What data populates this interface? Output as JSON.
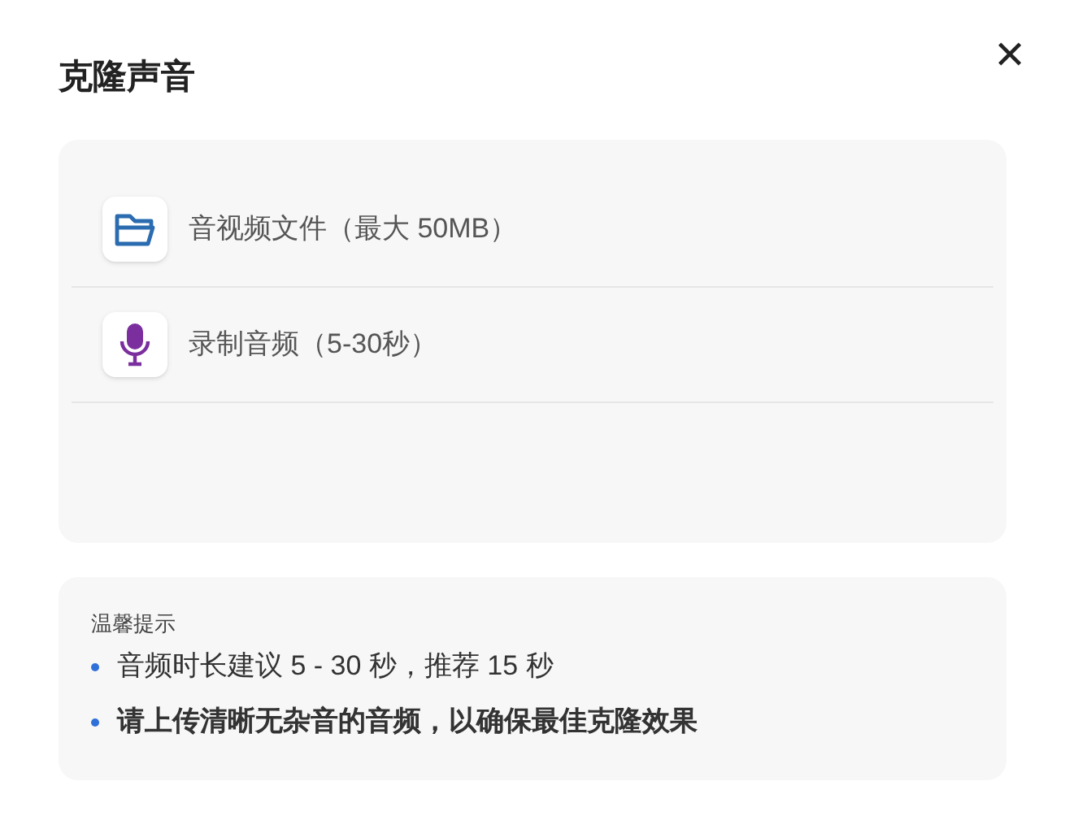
{
  "dialog": {
    "title": "克隆声音",
    "close": "✕"
  },
  "options": [
    {
      "kind": "file",
      "label": "音视频文件（最大 50MB）"
    },
    {
      "kind": "record",
      "label": "录制音频（5-30秒）"
    }
  ],
  "tips": {
    "heading": "温馨提示",
    "items": [
      {
        "text": "音频时长建议 5 - 30 秒，推荐 15 秒",
        "emphasis": false
      },
      {
        "text": "请上传清晰无杂音的音频，以确保最佳克隆效果",
        "emphasis": true
      }
    ]
  }
}
